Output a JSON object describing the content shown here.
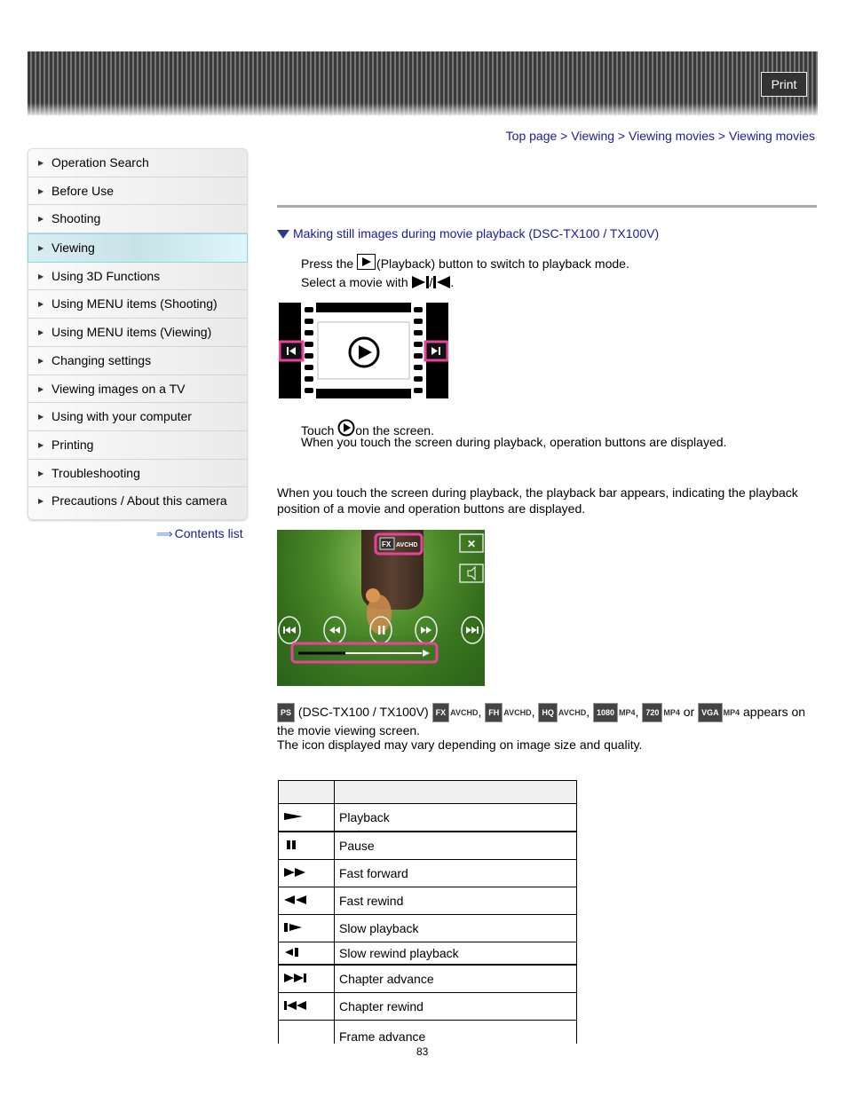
{
  "header": {
    "print_label": "Print"
  },
  "breadcrumb": [
    "Top page",
    "Viewing",
    "Viewing movies",
    "Viewing movies"
  ],
  "breadcrumb_sep": ">",
  "sidebar": {
    "items": [
      {
        "label": "Operation Search"
      },
      {
        "label": "Before Use"
      },
      {
        "label": "Shooting"
      },
      {
        "label": "Viewing",
        "active": true
      },
      {
        "label": "Using 3D Functions"
      },
      {
        "label": "Using MENU items (Shooting)"
      },
      {
        "label": "Using MENU items (Viewing)"
      },
      {
        "label": "Changing settings"
      },
      {
        "label": "Viewing images on a TV"
      },
      {
        "label": "Using with your computer"
      },
      {
        "label": "Printing"
      },
      {
        "label": "Troubleshooting"
      },
      {
        "label": "Precautions / About this camera"
      }
    ],
    "contents_link": "Contents list"
  },
  "main": {
    "section_title": "Making still images during movie playback (DSC-TX100 / TX100V)",
    "step1_pre": "Press the",
    "step1_post": "(Playback) button to switch to playback mode.",
    "step2_pre": "Select a movie with",
    "step2_sep": "/",
    "step2_end": ".",
    "step3_pre": "Touch",
    "step3_post": "on the screen.",
    "step3_note": "When you touch the screen during playback, operation buttons are displayed.",
    "para1": "When you touch the screen during playback, the playback bar appears, indicating the playback position of a movie and operation buttons are displayed.",
    "icons_line": {
      "ps_badge": "PS",
      "model_text": "(DSC-TX100 / TX100V)",
      "badges": [
        {
          "badge": "FX",
          "format": "AVCHD"
        },
        {
          "badge": "FH",
          "format": "AVCHD"
        },
        {
          "badge": "HQ",
          "format": "AVCHD"
        },
        {
          "badge": "1080",
          "format": "MP4"
        },
        {
          "badge": "720",
          "format": "MP4"
        },
        {
          "badge": "VGA",
          "format": "MP4"
        }
      ],
      "or_text": "or",
      "tail": "appears on the movie viewing screen."
    },
    "para2": "The icon displayed may vary depending on image size and quality.",
    "movie_overlay": {
      "badge": "FX",
      "format": "AVCHD"
    },
    "table": {
      "headers": [
        "",
        ""
      ],
      "rows": [
        {
          "icon": "play-icon",
          "label": "Playback"
        },
        {
          "icon": "pause-icon",
          "label": "Pause"
        },
        {
          "icon": "fast-forward-icon",
          "label": "Fast forward"
        },
        {
          "icon": "fast-rewind-icon",
          "label": "Fast rewind"
        },
        {
          "icon": "slow-playback-icon",
          "label": "Slow playback"
        },
        {
          "icon": "slow-rewind-icon",
          "label": "Slow rewind playback"
        },
        {
          "icon": "chapter-advance-icon",
          "label": "Chapter advance"
        },
        {
          "icon": "chapter-rewind-icon",
          "label": "Chapter rewind"
        },
        {
          "icon": "",
          "label": "Frame advance"
        }
      ]
    }
  },
  "footer": {
    "page_number": "83"
  }
}
